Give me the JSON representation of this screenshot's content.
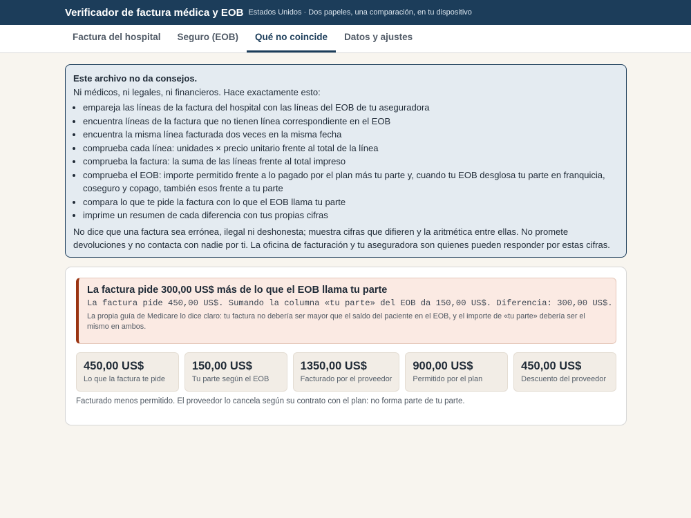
{
  "header": {
    "title": "Verificador de factura médica y EOB",
    "subtitle": "Estados Unidos · Dos papeles, una comparación, en tu dispositivo"
  },
  "tabs": [
    {
      "label": "Factura del hospital",
      "active": false
    },
    {
      "label": "Seguro (EOB)",
      "active": false
    },
    {
      "label": "Qué no coincide",
      "active": true
    },
    {
      "label": "Datos y ajustes",
      "active": false
    }
  ],
  "notice": {
    "heading": "Este archivo no da consejos.",
    "intro": "Ni médicos, ni legales, ni financieros. Hace exactamente esto:",
    "items": [
      "empareja las líneas de la factura del hospital con las líneas del EOB de tu aseguradora",
      "encuentra líneas de la factura que no tienen línea correspondiente en el EOB",
      "encuentra la misma línea facturada dos veces en la misma fecha",
      "comprueba cada línea: unidades × precio unitario frente al total de la línea",
      "comprueba la factura: la suma de las líneas frente al total impreso",
      "comprueba el EOB: importe permitido frente a lo pagado por el plan más tu parte y, cuando tu EOB desglosa tu parte en franquicia, coseguro y copago, también esos frente a tu parte",
      "compara lo que te pide la factura con lo que el EOB llama tu parte",
      "imprime un resumen de cada diferencia con tus propias cifras"
    ],
    "closing": "No dice que una factura sea errónea, ilegal ni deshonesta; muestra cifras que difieren y la aritmética entre ellas. No promete devoluciones y no contacta con nadie por ti. La oficina de facturación y tu aseguradora son quienes pueden responder por estas cifras."
  },
  "alert": {
    "heading": "La factura pide 300,00 US$ más de lo que el EOB llama tu parte",
    "detail": "La factura pide 450,00 US$. Sumando la columna «tu parte» del EOB da 150,00 US$. Diferencia: 300,00 US$.",
    "note": "La propia guía de Medicare lo dice claro: tu factura no debería ser mayor que el saldo del paciente en el EOB, y el importe de «tu parte» debería ser el mismo en ambos.",
    "accent_color": "#9a3412"
  },
  "metrics": [
    {
      "value": "450,00 US$",
      "label": "Lo que la factura te pide"
    },
    {
      "value": "150,00 US$",
      "label": "Tu parte según el EOB"
    },
    {
      "value": "1350,00 US$",
      "label": "Facturado por el proveedor"
    },
    {
      "value": "900,00 US$",
      "label": "Permitido por el plan"
    },
    {
      "value": "450,00 US$",
      "label": "Descuento del proveedor"
    }
  ],
  "footnote": "Facturado menos permitido. El proveedor lo cancela según su contrato con el plan: no forma parte de tu parte.",
  "colors": {
    "header_bg": "#1c3d5a",
    "page_bg": "#f8f5ef",
    "notice_bg": "#e4ebf1",
    "alert_bg": "#fbeae3"
  }
}
